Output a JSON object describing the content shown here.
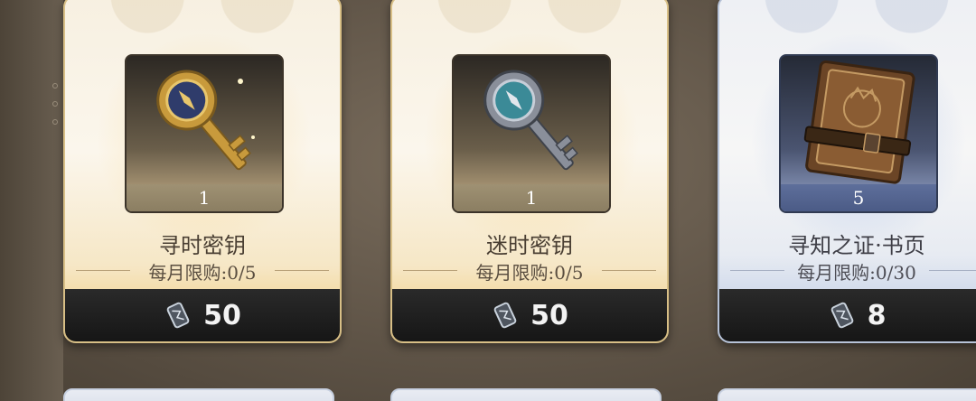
{
  "shop": {
    "items": [
      {
        "name": "寻时密钥",
        "quantity": "1",
        "limit": "每月限购:0/5",
        "price": "50",
        "icon": "gold-key-icon",
        "theme": "gold"
      },
      {
        "name": "迷时密钥",
        "quantity": "1",
        "limit": "每月限购:0/5",
        "price": "50",
        "icon": "silver-key-icon",
        "theme": "gold"
      },
      {
        "name": "寻知之证·书页",
        "quantity": "5",
        "limit": "每月限购:0/30",
        "price": "8",
        "icon": "book-icon",
        "theme": "blue"
      }
    ],
    "currency_icon": "crystal-currency-icon"
  },
  "colors": {
    "gold_accent": "#efc978",
    "blue_accent": "#b7c6e3",
    "price_bar": "#1c1c1c"
  }
}
